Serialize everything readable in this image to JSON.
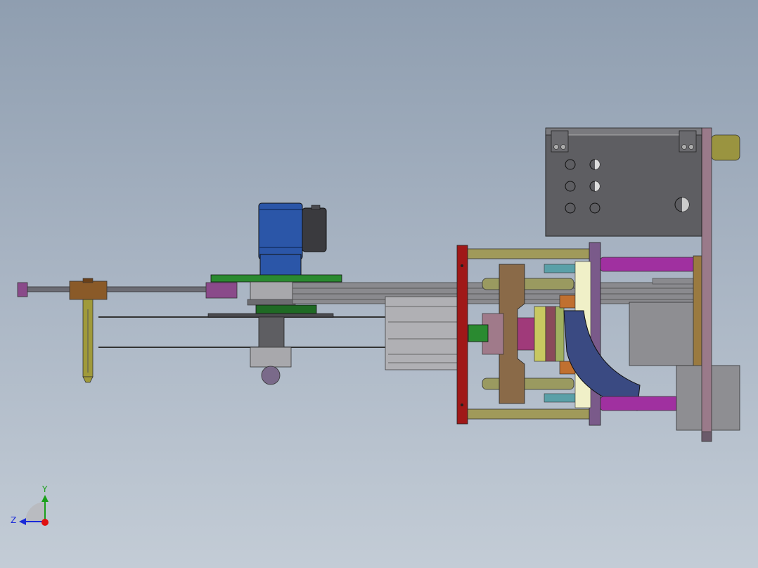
{
  "view": {
    "background_top": "#8f9eb0",
    "background_bottom": "#c3ccd6"
  },
  "triad": {
    "y_label": "Y",
    "z_label": "Z",
    "y_color": "#1aa01a",
    "z_color": "#1a2ad8",
    "x_color": "#e01010"
  },
  "colors": {
    "motor_blue": "#2b56a8",
    "frame_red": "#a01818",
    "rail_olive": "#a09a5a",
    "plate_purple": "#7a5a8a",
    "rod_magenta": "#a030a0",
    "rod_cyan": "#5aa0a8",
    "slider_brown": "#8a5a28",
    "flow_navy": "#3a4a82",
    "box_grey": "#5e5e5e",
    "body_grey": "#8a8a8a",
    "green_plate": "#2a8a30"
  },
  "icons": {
    "axis_triad": "axis-triad-icon"
  }
}
